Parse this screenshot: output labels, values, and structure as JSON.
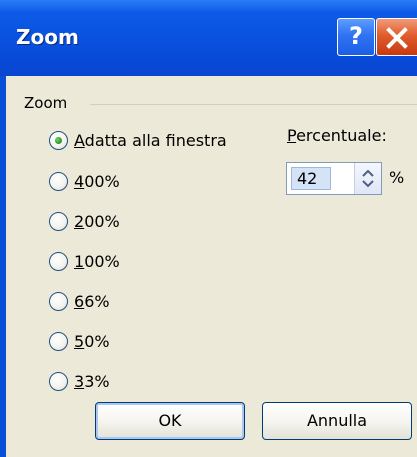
{
  "window": {
    "title": "Zoom",
    "help_glyph": "?",
    "close_icon": "close-icon"
  },
  "group": {
    "label": "Zoom"
  },
  "options": [
    {
      "label": "Adatta alla finestra",
      "accel": "A",
      "rest": "datta alla finestra",
      "checked": true
    },
    {
      "label": "400%",
      "accel": "4",
      "rest": "00%",
      "checked": false
    },
    {
      "label": "200%",
      "accel": "2",
      "rest": "00%",
      "checked": false
    },
    {
      "label": "100%",
      "accel": "1",
      "rest": "00%",
      "checked": false
    },
    {
      "label": "66%",
      "accel": "6",
      "rest": "6%",
      "checked": false
    },
    {
      "label": "50%",
      "accel": "5",
      "rest": "0%",
      "checked": false
    },
    {
      "label": "33%",
      "accel": "3",
      "rest": "3%",
      "checked": false
    }
  ],
  "percentage": {
    "label_accel": "P",
    "label_rest": "ercentuale:",
    "value": "42",
    "unit": "%"
  },
  "buttons": {
    "ok": "OK",
    "cancel": "Annulla"
  },
  "colors": {
    "titlebar": "#0a51e0",
    "dialog_bg": "#ece9d8",
    "close_button": "#e15c2d",
    "radio_selected": "#2f9b27"
  }
}
